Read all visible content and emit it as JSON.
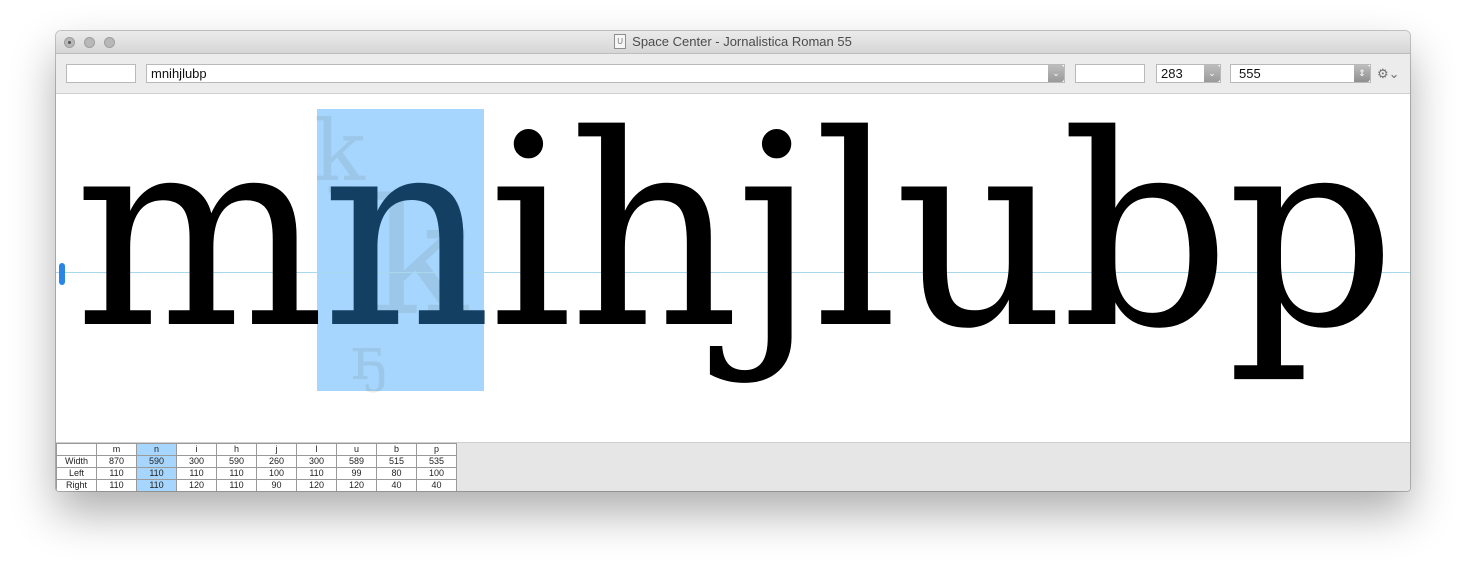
{
  "window": {
    "title": "Space Center - Jornalistica Roman 55"
  },
  "toolbar": {
    "left_field_value": "",
    "text_input_value": "mnihjlubp",
    "middle_field_value": "",
    "size_value": "283",
    "line_height_value": "555",
    "gear_icon": "gear-icon"
  },
  "preview": {
    "text": "mnihjlubp",
    "before_selected": "m",
    "selected_glyph": "n",
    "after_selected": "ihjlubp"
  },
  "metrics": {
    "row_labels": [
      "Width",
      "Left",
      "Right"
    ],
    "selected_index": 1,
    "glyphs": [
      {
        "name": "m",
        "width": "870",
        "left": "110",
        "right": "110"
      },
      {
        "name": "n",
        "width": "590",
        "left": "110",
        "right": "110"
      },
      {
        "name": "i",
        "width": "300",
        "left": "110",
        "right": "120"
      },
      {
        "name": "h",
        "width": "590",
        "left": "110",
        "right": "110"
      },
      {
        "name": "j",
        "width": "260",
        "left": "100",
        "right": "90"
      },
      {
        "name": "l",
        "width": "300",
        "left": "110",
        "right": "120"
      },
      {
        "name": "u",
        "width": "589",
        "left": "99",
        "right": "120"
      },
      {
        "name": "b",
        "width": "515",
        "left": "80",
        "right": "40"
      },
      {
        "name": "p",
        "width": "535",
        "left": "100",
        "right": "40"
      }
    ]
  },
  "colors": {
    "selection": "#a6d6fd",
    "baseline": "#a9d8ee",
    "accent": "#2a86e6"
  }
}
